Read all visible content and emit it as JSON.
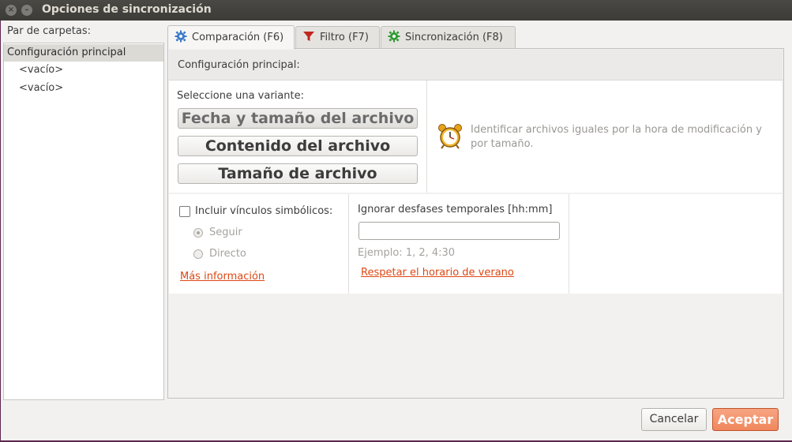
{
  "window": {
    "title": "Opciones de sincronización"
  },
  "folder_pairs": {
    "label": "Par de carpetas:",
    "items": [
      {
        "label": "Configuración principal",
        "selected": true
      },
      {
        "label": "<vacío>"
      },
      {
        "label": "<vacío>"
      }
    ]
  },
  "tabs": [
    {
      "label": "Comparación (F6)",
      "icon": "gear-icon",
      "active": true
    },
    {
      "label": "Filtro (F7)",
      "icon": "filter-icon"
    },
    {
      "label": "Sincronización (F8)",
      "icon": "sync-gear-icon"
    }
  ],
  "comparison": {
    "header": "Configuración principal:",
    "variant_label": "Seleccione una variante:",
    "variants": [
      {
        "label": "Fecha y tamaño del archivo",
        "selected": true
      },
      {
        "label": "Contenido del archivo"
      },
      {
        "label": "Tamaño de archivo"
      }
    ],
    "description": "Identificar archivos iguales por la hora de modificación y por tamaño.",
    "symlinks": {
      "checkbox_label": "Incluir vínculos simbólicos:",
      "checked": false,
      "options": [
        {
          "label": "Seguir",
          "selected": true
        },
        {
          "label": "Directo"
        }
      ],
      "more_info": "Más información"
    },
    "time_shift": {
      "label": "Ignorar desfases temporales [hh:mm]",
      "value": "",
      "example": "Ejemplo:  1, 2, 4:30",
      "dst_link": "Respetar el horario de verano"
    }
  },
  "buttons": {
    "cancel": "Cancelar",
    "ok": "Aceptar"
  },
  "colors": {
    "accent": "#f0875c",
    "link": "#dd4814",
    "titlebar": "#3c3b37"
  }
}
